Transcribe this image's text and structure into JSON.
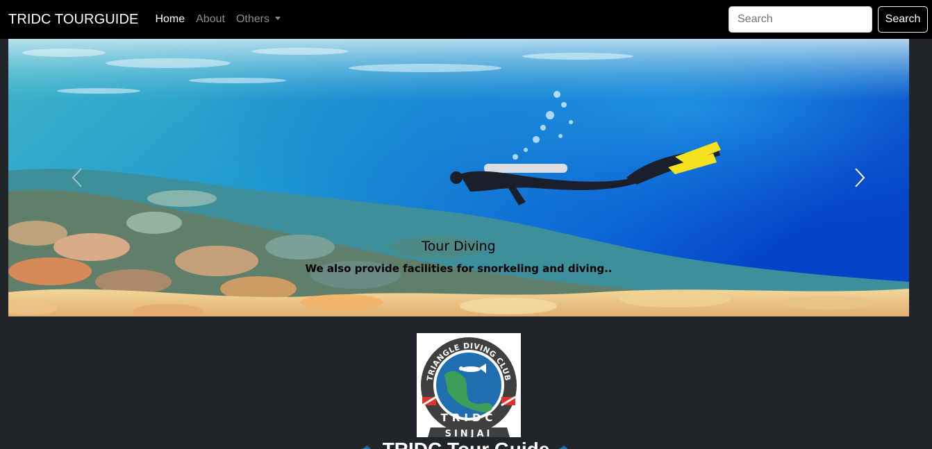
{
  "navbar": {
    "brand": "TRIDC TOURGUIDE",
    "links": [
      {
        "label": "Home",
        "active": true
      },
      {
        "label": "About",
        "active": false
      },
      {
        "label": "Others",
        "active": false,
        "dropdown": true
      }
    ],
    "search": {
      "placeholder": "Search",
      "button_label": "Search"
    }
  },
  "carousel": {
    "caption_title": "Tour Diving",
    "caption_text": "We also provide facilities for snorkeling and diving.."
  },
  "logo": {
    "top_text": "TRIANGLE DIVING CLUB",
    "mid_text": "TRIDC",
    "bottom_text": "SINJAI"
  },
  "club_title": {
    "icon_left": "fish-icon",
    "text": "TRIDC Tour Guide",
    "icon_right": "fish-icon"
  },
  "colors": {
    "navbar_bg": "#000000",
    "page_bg": "#212529",
    "ocean_deep": "#0a5fd6",
    "logo_blue": "#1f6fb0"
  }
}
